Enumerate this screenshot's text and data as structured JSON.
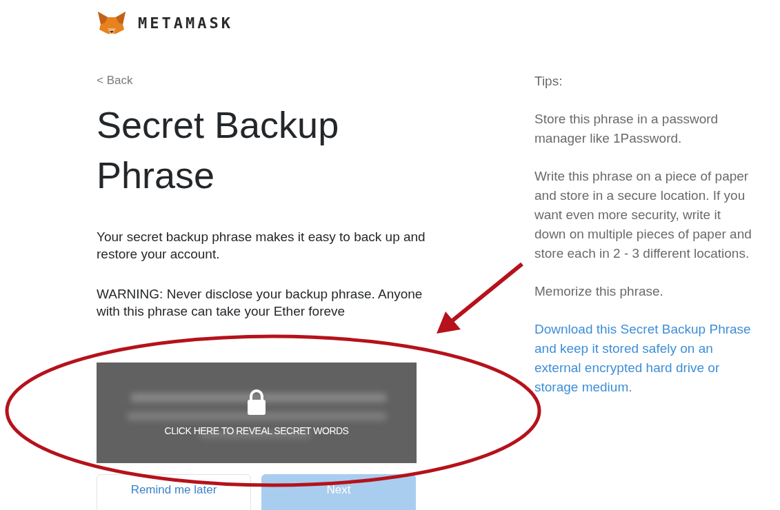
{
  "header": {
    "brand": "METAMASK"
  },
  "back_link": "< Back",
  "title": "Secret Backup Phrase",
  "description": "Your secret backup phrase makes it easy to back up and restore your account.",
  "warning": "WARNING: Never disclose your backup phrase. Anyone with this phrase can take your Ether foreve",
  "reveal_panel": {
    "label": "CLICK HERE TO REVEAL SECRET WORDS"
  },
  "buttons": [
    {
      "label": "Remind me later",
      "kind": "secondary",
      "disabled": false
    },
    {
      "label": "Next",
      "kind": "primary",
      "disabled": true
    }
  ],
  "tips": {
    "heading": "Tips:",
    "items": [
      {
        "text": "Store this phrase in a password manager like 1Password.",
        "kind": "text"
      },
      {
        "text": "Write this phrase on a piece of paper and store in a secure location. If you want even more security, write it down on multiple pieces of paper and store each in 2 - 3 different locations.",
        "kind": "text"
      },
      {
        "text": "Memorize this phrase.",
        "kind": "text"
      },
      {
        "text": "Download this Secret Backup Phrase and keep it stored safely on an external encrypted hard drive or storage medium.",
        "kind": "link"
      }
    ]
  }
}
